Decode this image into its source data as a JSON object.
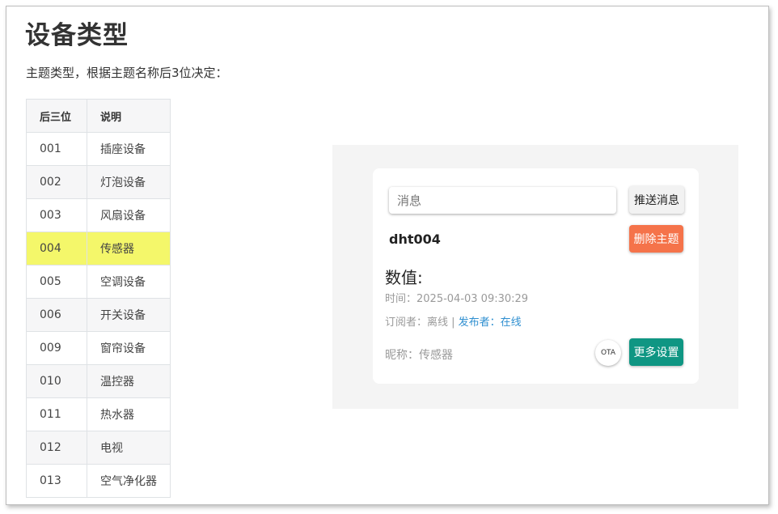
{
  "page": {
    "title": "设备类型",
    "intro": "主题类型，根据主题名称后3位决定："
  },
  "table": {
    "headers": [
      "后三位",
      "说明"
    ],
    "rows": [
      {
        "code": "001",
        "desc": "插座设备"
      },
      {
        "code": "002",
        "desc": "灯泡设备"
      },
      {
        "code": "003",
        "desc": "风扇设备"
      },
      {
        "code": "004",
        "desc": "传感器"
      },
      {
        "code": "005",
        "desc": "空调设备"
      },
      {
        "code": "006",
        "desc": "开关设备"
      },
      {
        "code": "009",
        "desc": "窗帘设备"
      },
      {
        "code": "010",
        "desc": "温控器"
      },
      {
        "code": "011",
        "desc": "热水器"
      },
      {
        "code": "012",
        "desc": "电视"
      },
      {
        "code": "013",
        "desc": "空气净化器"
      }
    ],
    "highlight_color": "#f4f76a"
  },
  "device_card": {
    "message_placeholder": "消息",
    "send_label": "推送消息",
    "device_name": "dht004",
    "delete_label": "删除主题",
    "value_label": "数值:",
    "time_text": "时间：2025-04-03 09:30:29",
    "subscriber_text": "订阅者：离线 | ",
    "publisher_text": "发布者：在线",
    "nickname_text": "昵称：传感器",
    "ota_label": "OTA",
    "more_label": "更多设置",
    "colors": {
      "delete": "#f5734a",
      "more": "#0f9683",
      "publisher": "#2f8fd0"
    }
  }
}
